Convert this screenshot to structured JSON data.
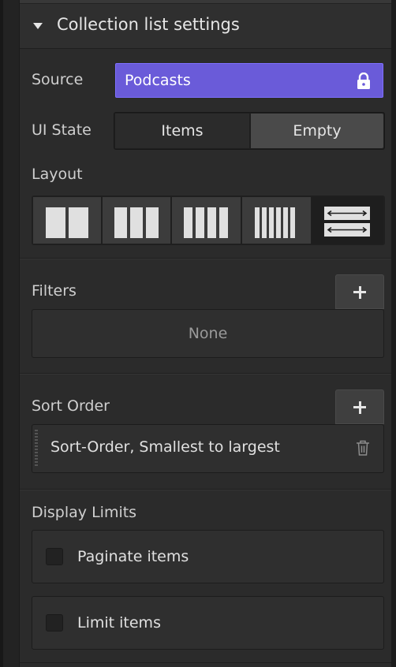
{
  "section": {
    "title": "Collection list settings"
  },
  "source": {
    "label": "Source",
    "value": "Podcasts",
    "locked_icon": "lock-icon"
  },
  "ui_state": {
    "label": "UI State",
    "options": [
      "Items",
      "Empty"
    ],
    "selected": "Items"
  },
  "layout": {
    "label": "Layout",
    "options": [
      "2 columns",
      "3 columns",
      "4 columns",
      "6 columns",
      "full width"
    ],
    "selected": "full width"
  },
  "filters": {
    "label": "Filters",
    "empty_text": "None"
  },
  "sort_order": {
    "label": "Sort Order",
    "items": [
      "Sort-Order, Smallest to largest"
    ]
  },
  "display_limits": {
    "label": "Display Limits",
    "options": [
      {
        "label": "Paginate items",
        "checked": false
      },
      {
        "label": "Limit items",
        "checked": false
      }
    ]
  },
  "colors": {
    "accent": "#6a5bd9",
    "panel_bg": "#2b2b2b"
  }
}
